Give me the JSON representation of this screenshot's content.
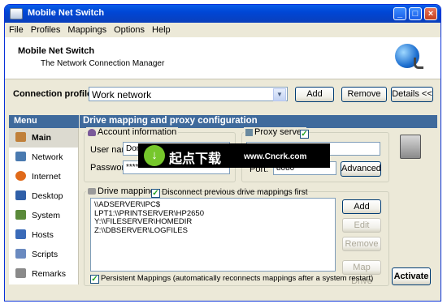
{
  "window": {
    "title": "Mobile Net Switch"
  },
  "menu": [
    "File",
    "Profiles",
    "Mappings",
    "Options",
    "Help"
  ],
  "header": {
    "title": "Mobile Net Switch",
    "subtitle": "The Network Connection Manager"
  },
  "profile": {
    "label": "Connection profile:",
    "value": "Work network",
    "add": "Add",
    "remove": "Remove",
    "details": "Details <<"
  },
  "sidebar": {
    "header": "Menu",
    "items": [
      {
        "label": "Main",
        "icon": "home-icon",
        "color": "#c0803a"
      },
      {
        "label": "Network",
        "icon": "network-icon",
        "color": "#4a7ab0"
      },
      {
        "label": "Internet",
        "icon": "firefox-icon",
        "color": "#e06a1a"
      },
      {
        "label": "Desktop",
        "icon": "desktop-icon",
        "color": "#2f5fa8"
      },
      {
        "label": "System",
        "icon": "system-icon",
        "color": "#5a8a3a"
      },
      {
        "label": "Hosts",
        "icon": "hosts-icon",
        "color": "#3a6ab8"
      },
      {
        "label": "Scripts",
        "icon": "scripts-icon",
        "color": "#6a8ac0"
      },
      {
        "label": "Remarks",
        "icon": "remarks-icon",
        "color": "#8a8a8a"
      }
    ]
  },
  "content": {
    "header": "Drive mapping and proxy configuration"
  },
  "account": {
    "legend": "Account information",
    "user_label": "User name:",
    "user_value": "Dom",
    "password_label": "Password:",
    "password_value": "*****"
  },
  "proxy": {
    "legend": "Proxy server",
    "checked": true,
    "server_value": "/Server",
    "port_label": "Port:",
    "port_value": "8080",
    "advanced": "Advanced"
  },
  "drives": {
    "legend": "Drive mappings",
    "disconnect_label": "Disconnect previous drive mappings first",
    "list": [
      "\\\\ADSERVER\\IPC$",
      "LPT1:\\\\PRINTSERVER\\HP2650",
      "Y:\\\\FILESERVER\\HOMEDIR",
      "Z:\\\\DBSERVER\\LOGFILES"
    ],
    "add": "Add",
    "edit": "Edit",
    "remove": "Remove",
    "map": "Map Drive",
    "persistent_label": "Persistent Mappings (automatically reconnects mappings after a system restart)"
  },
  "activate": "Activate",
  "watermark": {
    "text": "起点下载",
    "url": "www.Cncrk.com",
    "color": "#76c72b"
  }
}
